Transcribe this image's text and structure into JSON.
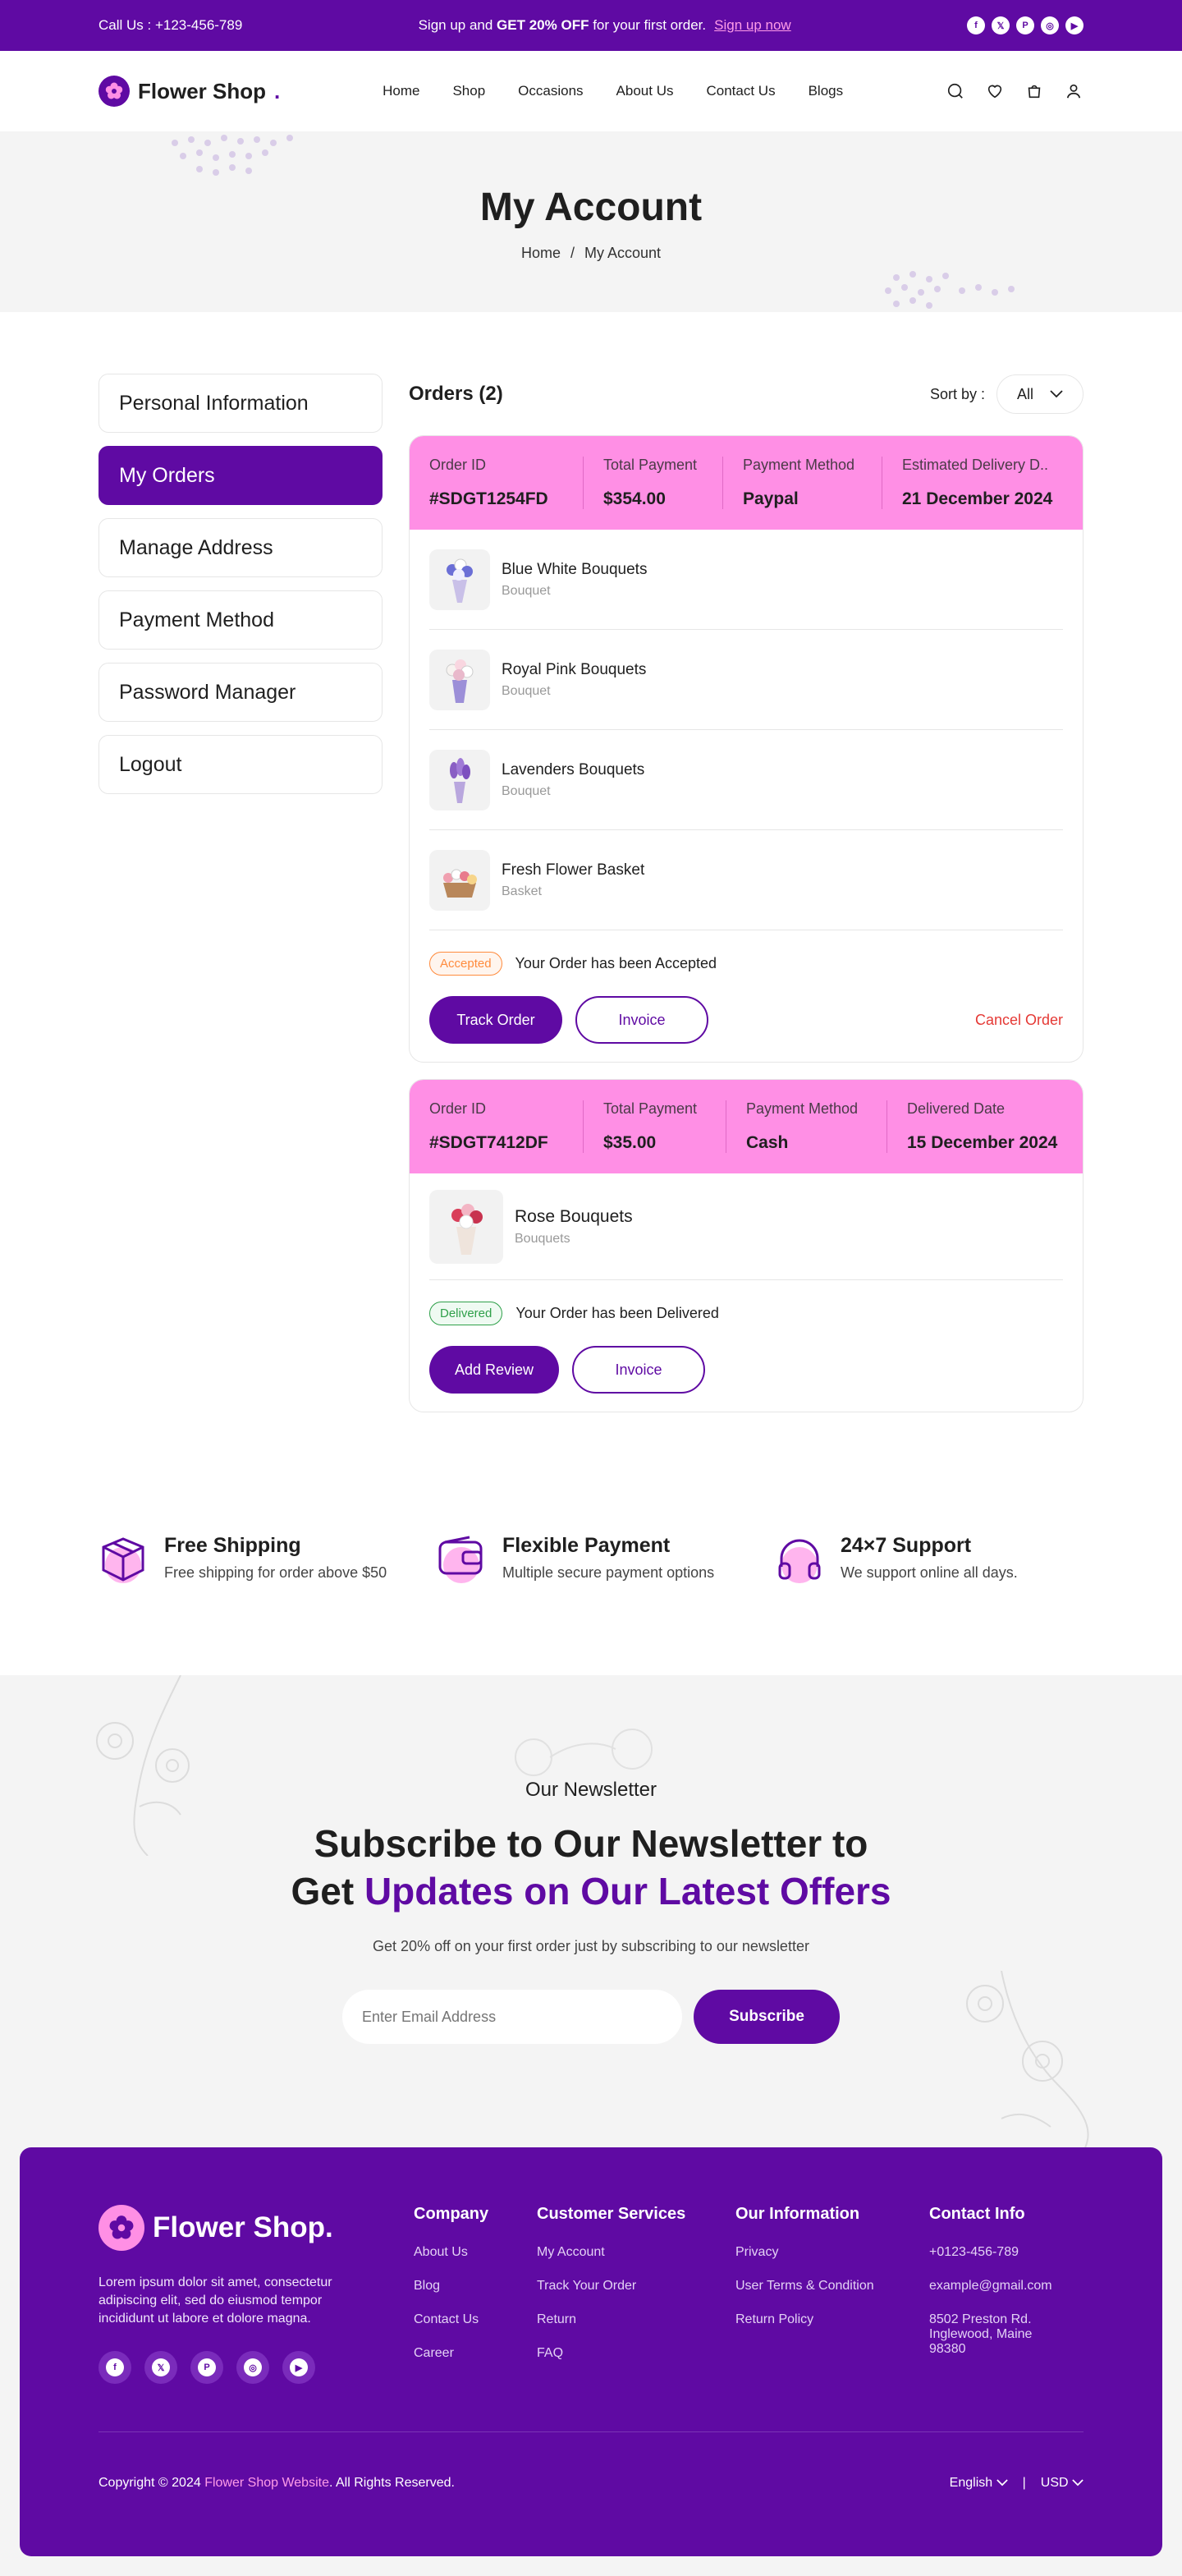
{
  "topbar": {
    "phone": "Call Us : +123-456-789",
    "promo_pre": "Sign up and ",
    "promo_bold": "GET 20% OFF",
    "promo_post": " for your first order.",
    "promo_link": "Sign up now",
    "socials": [
      "facebook-icon",
      "x-icon",
      "pinterest-icon",
      "instagram-icon",
      "youtube-icon"
    ]
  },
  "header": {
    "logo_text": "Flower Shop",
    "logo_dot": ".",
    "nav": [
      "Home",
      "Shop",
      "Occasions",
      "About Us",
      "Contact Us",
      "Blogs"
    ],
    "icons": [
      "search-icon",
      "heart-icon",
      "cart-icon",
      "user-icon"
    ]
  },
  "hero": {
    "title": "My Account",
    "breadcrumb_home": "Home",
    "breadcrumb_sep": "/",
    "breadcrumb_current": "My Account"
  },
  "sidebar": {
    "items": [
      {
        "label": "Personal Information",
        "active": false
      },
      {
        "label": "My Orders",
        "active": true
      },
      {
        "label": "Manage Address",
        "active": false
      },
      {
        "label": "Payment Method",
        "active": false
      },
      {
        "label": "Password Manager",
        "active": false
      },
      {
        "label": "Logout",
        "active": false
      }
    ]
  },
  "orders": {
    "title": "Orders (2)",
    "sort_label": "Sort by :",
    "sort_value": "All",
    "list": [
      {
        "meta": [
          {
            "label": "Order ID",
            "value": "#SDGT1254FD"
          },
          {
            "label": "Total Payment",
            "value": "$354.00"
          },
          {
            "label": "Payment Method",
            "value": "Paypal"
          },
          {
            "label": "Estimated Delivery D..",
            "value": "21 December 2024"
          }
        ],
        "items": [
          {
            "name": "Blue White Bouquets",
            "type": "Bouquet"
          },
          {
            "name": "Royal Pink Bouquets",
            "type": "Bouquet"
          },
          {
            "name": "Lavenders Bouquets",
            "type": "Bouquet"
          },
          {
            "name": "Fresh Flower Basket",
            "type": "Basket"
          }
        ],
        "status_badge": "Accepted",
        "status_text": "Your Order has been Accepted",
        "primary_btn": "Track Order",
        "secondary_btn": "Invoice",
        "cancel_btn": "Cancel Order"
      },
      {
        "meta": [
          {
            "label": "Order ID",
            "value": "#SDGT7412DF"
          },
          {
            "label": "Total Payment",
            "value": "$35.00"
          },
          {
            "label": "Payment Method",
            "value": "Cash"
          },
          {
            "label": "Delivered Date",
            "value": "15 December 2024"
          }
        ],
        "items": [
          {
            "name": "Rose Bouquets",
            "type": "Bouquets"
          }
        ],
        "status_badge": "Delivered",
        "status_text": "Your Order has been Delivered",
        "primary_btn": "Add Review",
        "secondary_btn": "Invoice"
      }
    ]
  },
  "features": [
    {
      "title": "Free Shipping",
      "desc": "Free shipping for order above $50",
      "icon": "box-icon"
    },
    {
      "title": "Flexible Payment",
      "desc": "Multiple secure payment options",
      "icon": "wallet-icon"
    },
    {
      "title": "24×7 Support",
      "desc": "We support online all days.",
      "icon": "headset-icon"
    }
  ],
  "newsletter": {
    "subtitle": "Our Newsletter",
    "title_line1": "Subscribe to Our Newsletter to",
    "title_line2_pre": "Get ",
    "title_line2_hl": "Updates on Our Latest Offers",
    "desc": "Get 20% off on your first order just by subscribing to our newsletter",
    "placeholder": "Enter Email Address",
    "button": "Subscribe"
  },
  "footer": {
    "logo_text": "Flower Shop.",
    "about": "Lorem ipsum dolor sit amet, consectetur adipiscing elit, sed do eiusmod tempor incididunt ut labore et dolore magna.",
    "socials": [
      "facebook-icon",
      "x-icon",
      "pinterest-icon",
      "instagram-icon",
      "youtube-icon"
    ],
    "columns": [
      {
        "title": "Company",
        "links": [
          "About Us",
          "Blog",
          "Contact Us",
          "Career"
        ]
      },
      {
        "title": "Customer Services",
        "links": [
          "My Account",
          "Track Your Order",
          "Return",
          "FAQ"
        ]
      },
      {
        "title": "Our Information",
        "links": [
          "Privacy",
          "User Terms & Condition",
          "Return Policy"
        ]
      },
      {
        "title": "Contact Info",
        "links": [
          "+0123-456-789",
          "example@gmail.com",
          "8502 Preston Rd. Inglewood, Maine 98380"
        ]
      }
    ],
    "copyright_pre": "Copyright © 2024 ",
    "copyright_link": "Flower Shop Website",
    "copyright_post": ". All Rights Reserved.",
    "language": "English",
    "currency": "USD",
    "lang_sep": "|"
  },
  "colors": {
    "brand": "#5f0aa3",
    "accent_pink": "#ff8fe5",
    "accepted": "#ff8b3d",
    "delivered": "#2fa04a",
    "cancel": "#e53935"
  }
}
